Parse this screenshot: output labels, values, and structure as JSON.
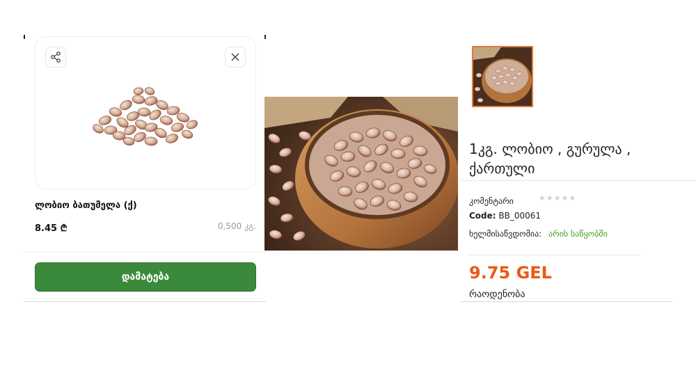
{
  "left_panel": {
    "icons": {
      "share": "share-icon",
      "close": "close-icon"
    },
    "product_name": "ლობიო ბათუმელა (ქ)",
    "price": "8.45 ₾",
    "weight": "0,500 კგ.",
    "add_button_label": "დამატება",
    "colors": {
      "button": "#3b8a3b"
    }
  },
  "right_panel": {
    "title": "1კგ. ლობიო , გურულა , ქართული",
    "comments_label": "კომენტარი",
    "rating_stars": "★★★★★",
    "code_label": "Code:",
    "code_value": "BB_00061",
    "availability_label": "ხელმისაწვდომია:",
    "availability_value": "არის საწყობში",
    "price": "9.75 GEL",
    "quantity_label": "რაოდენობა",
    "colors": {
      "price": "#e85a13",
      "availability": "#3f9e1e",
      "thumb_border": "#e07a35"
    }
  }
}
